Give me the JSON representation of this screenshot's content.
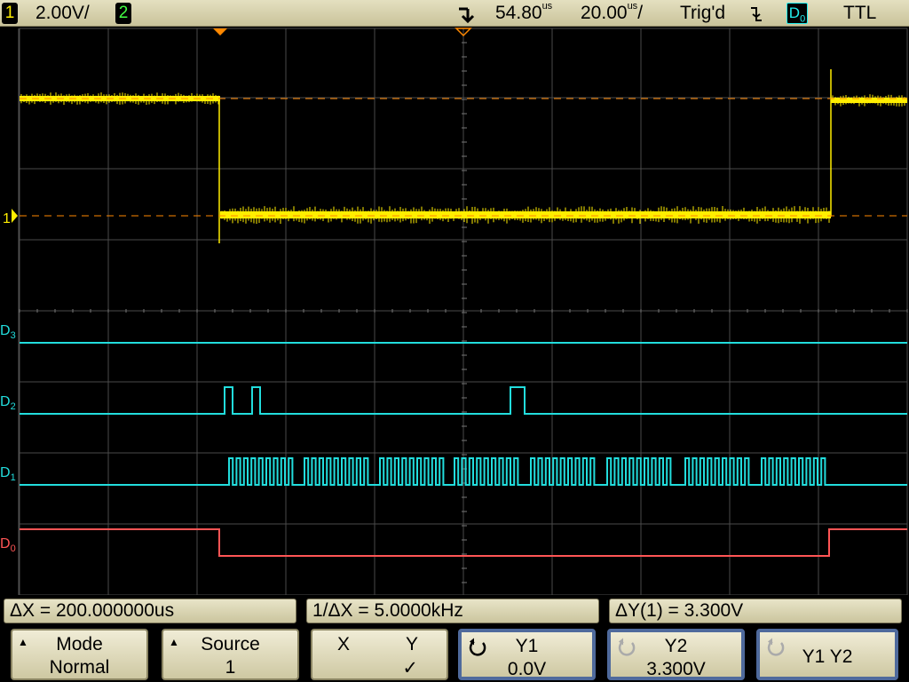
{
  "topbar": {
    "ch1_num": "1",
    "ch1_scale": "2.00V/",
    "ch2_num": "2",
    "trigger_marker_icon": "trigger-arrow-icon",
    "delay": "54.80",
    "delay_unit": "us",
    "timebase": "20.00",
    "timebase_unit": "us",
    "timebase_slash": "/",
    "trig_status": "Trig'd",
    "trig_edge_icon": "falling-edge-icon",
    "trig_source": "D",
    "trig_source_sub": "0",
    "trig_level": "TTL"
  },
  "channels": {
    "ch1_ground_label": "1",
    "d3_label": "D",
    "d3_sub": "3",
    "d2_label": "D",
    "d2_sub": "2",
    "d1_label": "D",
    "d1_sub": "1",
    "d0_label": "D",
    "d0_sub": "0"
  },
  "colors": {
    "ch1": "#ffee00",
    "digital": "#22dddd",
    "d0": "#ff5555",
    "grid": "#4a4a4a",
    "cursor_x": "#ff8800"
  },
  "measurements": {
    "delta_x": "ΔX = 200.000000us",
    "inv_delta_x": "1/ΔX = 5.0000kHz",
    "delta_y": "ΔY(1) = 3.300V"
  },
  "softkeys": {
    "mode_label": "Mode",
    "mode_value": "Normal",
    "source_label": "Source",
    "source_value": "1",
    "x_label": "X",
    "y_label": "Y",
    "y_check": "✓",
    "y1_label": "Y1",
    "y1_value": "0.0V",
    "y2_label": "Y2",
    "y2_value": "3.300V",
    "y1y2_label": "Y1 Y2"
  }
}
